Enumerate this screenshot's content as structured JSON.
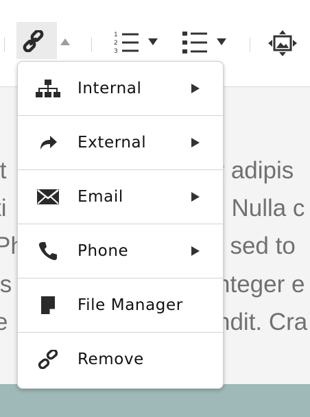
{
  "toolbar": {
    "buttons": [
      {
        "name": "link-button",
        "icon": "link-icon",
        "active": true,
        "caret": "up"
      },
      {
        "name": "ordered-list-button",
        "icon": "ordered-list-icon",
        "caret": "down"
      },
      {
        "name": "unordered-list-button",
        "icon": "unordered-list-icon",
        "caret": "down"
      },
      {
        "name": "media-button",
        "icon": "image-move-icon"
      }
    ]
  },
  "link_menu": {
    "items": [
      {
        "label": "Internal",
        "icon": "sitemap-icon",
        "has_submenu": true
      },
      {
        "label": "External",
        "icon": "share-arrow-icon",
        "has_submenu": true
      },
      {
        "label": "Email",
        "icon": "envelope-icon",
        "has_submenu": true
      },
      {
        "label": "Phone",
        "icon": "phone-icon",
        "has_submenu": true
      },
      {
        "label": "File Manager",
        "icon": "file-icon",
        "has_submenu": false
      },
      {
        "label": "Remove",
        "icon": "unlink-icon",
        "has_submenu": false
      }
    ]
  },
  "content": {
    "lines": [
      "it",
      "ti",
      "Ph",
      "is",
      "e"
    ],
    "lines_right": [
      "ur adipis",
      ". Nulla c",
      "t sed to",
      "nteger e",
      "ndit. Cra"
    ]
  },
  "colors": {
    "menu_border": "#cfcfcf",
    "active_button_bg": "#ebebeb",
    "content_text": "#707070",
    "footer_bar": "#9fb9b8"
  }
}
